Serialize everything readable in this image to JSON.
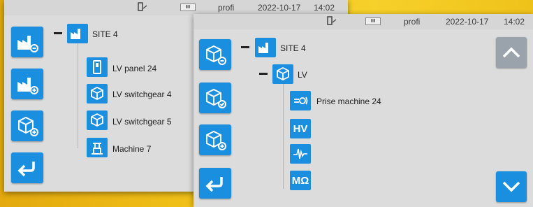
{
  "back_screen": {
    "status": {
      "user": "profi",
      "date": "2022-10-17",
      "time": "14:02"
    },
    "tree": {
      "root": {
        "label": "SITE 4"
      },
      "children": [
        {
          "label": "LV panel 24",
          "icon": "panel-icon"
        },
        {
          "label": "LV switchgear 4",
          "icon": "cube-check-icon"
        },
        {
          "label": "LV switchgear 5",
          "icon": "cube-check-icon"
        },
        {
          "label": "Machine 7",
          "icon": "machine-icon"
        }
      ]
    },
    "sidebar": [
      "factory-minus-icon",
      "factory-plus-icon",
      "cube-plus-icon",
      "back-arrow-icon"
    ]
  },
  "front_screen": {
    "status": {
      "user": "profi",
      "date": "2022-10-17",
      "time": "14:02"
    },
    "tree": {
      "root": {
        "label": "SITE 4"
      },
      "child": {
        "label": "LV"
      },
      "items": [
        {
          "label": "Prise machine 24",
          "icon": "outlet-icon"
        },
        {
          "label": "",
          "icon_text": "HV"
        },
        {
          "label": "",
          "icon": "waveform-icon"
        },
        {
          "label": "",
          "icon_text": "MΩ"
        }
      ]
    },
    "sidebar": [
      "cube-minus-icon",
      "cube-check-icon",
      "cube-plus-icon",
      "back-arrow-icon"
    ]
  },
  "colors": {
    "accent": "#1a8fe0",
    "screen_bg": "#dcdcdc",
    "frame": "#f2c319"
  }
}
